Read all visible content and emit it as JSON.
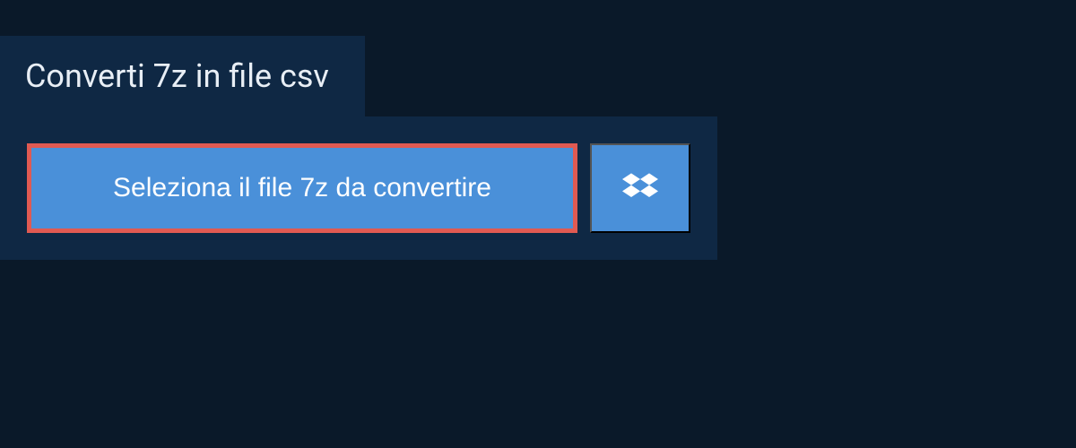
{
  "header": {
    "title": "Converti 7z in file csv"
  },
  "actions": {
    "select_file_label": "Seleziona il file 7z da convertire"
  },
  "colors": {
    "background_dark": "#0a1929",
    "panel_bg": "#0f2844",
    "button_bg": "#4a90d9",
    "button_border_highlight": "#e05a52",
    "text_light": "#e8eef5",
    "text_white": "#ffffff"
  }
}
